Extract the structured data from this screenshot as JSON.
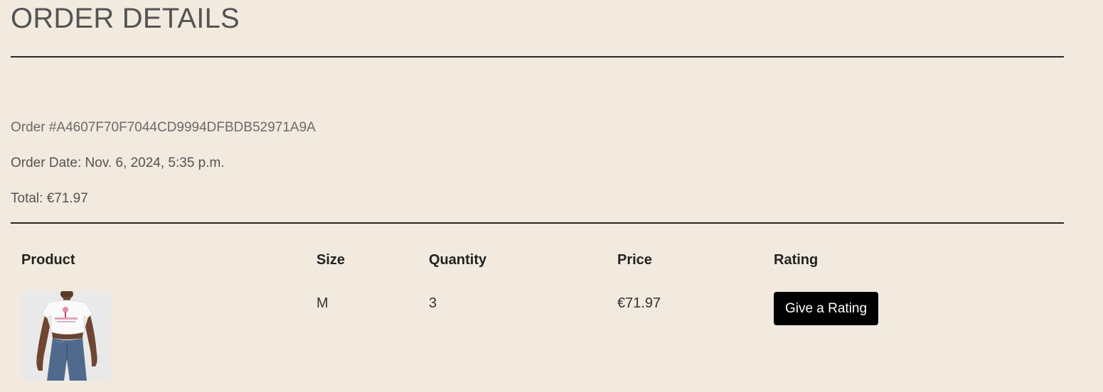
{
  "page": {
    "title": "ORDER DETAILS"
  },
  "order": {
    "number": "Order #A4607F70F7044CD9994DFBDB52971A9A",
    "date": "Order Date: Nov. 6, 2024, 5:35 p.m.",
    "total": "Total: €71.97"
  },
  "table": {
    "headers": {
      "product": "Product",
      "size": "Size",
      "quantity": "Quantity",
      "price": "Price",
      "rating": "Rating"
    },
    "rows": [
      {
        "image": "product-thumbnail",
        "size": "M",
        "quantity": "3",
        "price": "€71.97",
        "rating_button": "Give a Rating"
      }
    ]
  },
  "colors": {
    "background": "#f2e9df",
    "title": "#545454",
    "rule": "#2a2725",
    "button_bg": "#000000",
    "button_text": "#ffffff"
  }
}
